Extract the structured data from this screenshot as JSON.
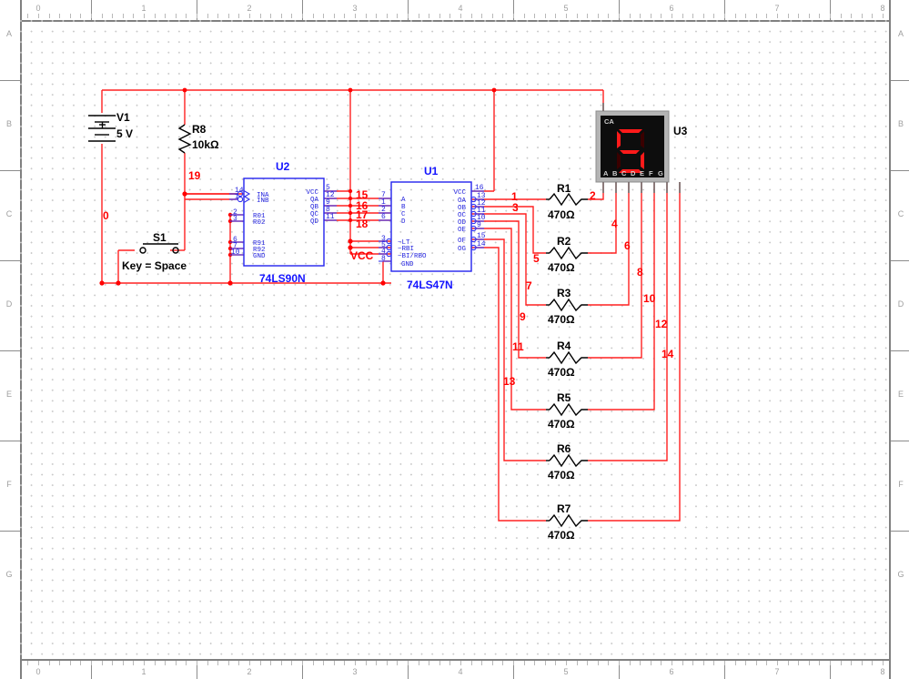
{
  "app": {
    "kind": "circuit-schematic-editor",
    "background": "#ffffff",
    "grid_color": "#c9c9c9"
  },
  "rulers": {
    "top_labels": [
      "0",
      "1",
      "2",
      "3",
      "4",
      "5",
      "6",
      "7",
      "8"
    ],
    "bottom_labels": [
      "0",
      "1",
      "2",
      "3",
      "4",
      "5",
      "6",
      "7",
      "8"
    ],
    "left_labels": [
      "A",
      "B",
      "C",
      "D",
      "E",
      "F",
      "G"
    ],
    "right_labels": [
      "A",
      "B",
      "C",
      "D",
      "E",
      "F",
      "G"
    ]
  },
  "components": {
    "v1": {
      "ref": "V1",
      "value": "5 V",
      "type": "dc-voltage-source"
    },
    "r8": {
      "ref": "R8",
      "value": "10kΩ",
      "type": "resistor"
    },
    "s1": {
      "ref": "S1",
      "key_label": "Key = Space",
      "type": "spst-switch"
    },
    "u2": {
      "ref": "U2",
      "part": "74LS90N",
      "type": "decade-counter",
      "left_pins": [
        {
          "num": "14",
          "name": "INA",
          "inverted_bubble": true
        },
        {
          "num": "1",
          "name": "INB",
          "inverted_bubble": true
        },
        {
          "num": "2",
          "name": "R01",
          "inverted_bubble": false
        },
        {
          "num": "3",
          "name": "R02",
          "inverted_bubble": false
        },
        {
          "num": "6",
          "name": "R91",
          "inverted_bubble": false
        },
        {
          "num": "7",
          "name": "R92",
          "inverted_bubble": false
        },
        {
          "num": "10",
          "name": "GND",
          "inverted_bubble": false
        }
      ],
      "right_pins": [
        {
          "num": "5",
          "name": "VCC"
        },
        {
          "num": "12",
          "name": "QA"
        },
        {
          "num": "9",
          "name": "QB"
        },
        {
          "num": "8",
          "name": "QC"
        },
        {
          "num": "11",
          "name": "QD"
        }
      ]
    },
    "u1": {
      "ref": "U1",
      "part": "74LS47N",
      "type": "bcd-to-7seg-decoder",
      "left_pins": [
        {
          "num": "7",
          "name": "A",
          "inverted_bubble": false
        },
        {
          "num": "1",
          "name": "B",
          "inverted_bubble": false
        },
        {
          "num": "2",
          "name": "C",
          "inverted_bubble": false
        },
        {
          "num": "6",
          "name": "D",
          "inverted_bubble": false
        },
        {
          "num": "3",
          "name": "~LT",
          "inverted_bubble": true
        },
        {
          "num": "5",
          "name": "~RBI",
          "inverted_bubble": true
        },
        {
          "num": "4",
          "name": "~BI/RBO",
          "inverted_bubble": true
        },
        {
          "num": "8",
          "name": "GND",
          "inverted_bubble": false
        }
      ],
      "right_pins": [
        {
          "num": "16",
          "name": "VCC",
          "inverted_bubble": false
        },
        {
          "num": "13",
          "name": "OA",
          "inverted_bubble": true
        },
        {
          "num": "12",
          "name": "OB",
          "inverted_bubble": true
        },
        {
          "num": "11",
          "name": "OC",
          "inverted_bubble": true
        },
        {
          "num": "10",
          "name": "OD",
          "inverted_bubble": true
        },
        {
          "num": "9",
          "name": "OE",
          "inverted_bubble": true
        },
        {
          "num": "15",
          "name": "OF",
          "inverted_bubble": true
        },
        {
          "num": "14",
          "name": "OG",
          "inverted_bubble": true
        }
      ]
    },
    "u3": {
      "ref": "U3",
      "type": "seven-segment-display",
      "common": "CA",
      "displayed_digit": "5",
      "segment_labels": [
        "A",
        "B",
        "C",
        "D",
        "E",
        "F",
        "G"
      ],
      "lit_segments": [
        "a",
        "f",
        "g",
        "c",
        "d"
      ],
      "on_color": "#ff1a1a",
      "off_color": "#3a0000",
      "body_color": "#0d0d0d"
    },
    "resistors": [
      {
        "ref": "R1",
        "value": "470Ω"
      },
      {
        "ref": "R2",
        "value": "470Ω"
      },
      {
        "ref": "R3",
        "value": "470Ω"
      },
      {
        "ref": "R4",
        "value": "470Ω"
      },
      {
        "ref": "R5",
        "value": "470Ω"
      },
      {
        "ref": "R6",
        "value": "470Ω"
      },
      {
        "ref": "R7",
        "value": "470Ω"
      }
    ]
  },
  "net_labels": {
    "ground": "0",
    "pullup": "19",
    "vcc": "VCC",
    "counter_outputs": [
      "15",
      "16",
      "17",
      "18"
    ],
    "decoder_to_resistor": [
      "1",
      "3",
      "5",
      "7",
      "9",
      "11",
      "13"
    ],
    "resistor_to_display": [
      "2",
      "4",
      "6",
      "8",
      "10",
      "12",
      "14"
    ]
  },
  "colors": {
    "wire": "#ff2020",
    "chip_outline": "#2222ee",
    "net_label": "#ff0000",
    "component": "#000000",
    "grid_dot": "#c9c9c9",
    "ruler_text": "#9a9a9a"
  }
}
